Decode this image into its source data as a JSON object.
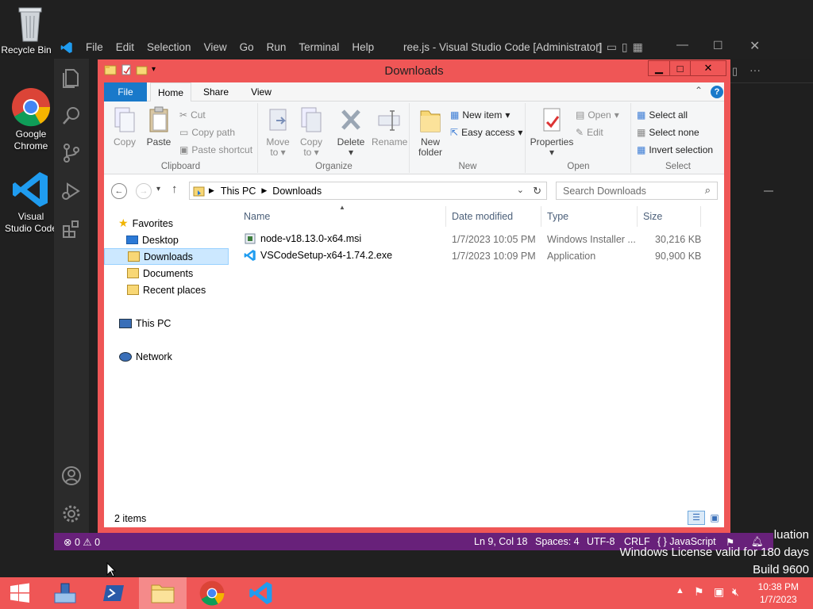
{
  "desktop": {
    "icons": [
      {
        "label": "Recycle Bin",
        "icon": "recycle-bin-icon"
      },
      {
        "label": "Google Chrome",
        "icon": "chrome-icon"
      },
      {
        "label": "Visual Studio Code",
        "icon": "vscode-icon"
      }
    ],
    "watermark": {
      "line1": "luation",
      "line2": "Windows License valid for 180 days",
      "line3": "Build 9600"
    }
  },
  "vscode": {
    "menu": [
      "File",
      "Edit",
      "Selection",
      "View",
      "Go",
      "Run",
      "Terminal",
      "Help"
    ],
    "title": "ree.js - Visual Studio Code [Administrator]",
    "status": {
      "errors": "0",
      "warnings": "0",
      "position": "Ln 9, Col 18",
      "spaces": "Spaces: 4",
      "encoding": "UTF-8",
      "eol": "CRLF",
      "language": "JavaScript"
    },
    "accent": "#68217a"
  },
  "explorer": {
    "title": "Downloads",
    "accent": "#ef5656",
    "tabs": [
      "File",
      "Home",
      "Share",
      "View"
    ],
    "ribbon": {
      "clipboard": {
        "copy": "Copy",
        "paste": "Paste",
        "cut": "Cut",
        "copy_path": "Copy path",
        "paste_shortcut": "Paste shortcut",
        "label": "Clipboard"
      },
      "organize": {
        "move_to": "Move",
        "move_to2": "to",
        "copy_to": "Copy",
        "copy_to2": "to",
        "delete": "Delete",
        "rename": "Rename",
        "label": "Organize"
      },
      "new": {
        "new_folder": "New",
        "new_folder2": "folder",
        "new_item": "New item",
        "easy_access": "Easy access",
        "label": "New"
      },
      "open": {
        "properties": "Properties",
        "open": "Open",
        "edit": "Edit",
        "label": "Open"
      },
      "select": {
        "select_all": "Select all",
        "select_none": "Select none",
        "invert": "Invert selection",
        "label": "Select"
      }
    },
    "address": {
      "segments": [
        "This PC",
        "Downloads"
      ]
    },
    "search_placeholder": "Search Downloads",
    "nav": {
      "favorites": "Favorites",
      "desktop": "Desktop",
      "downloads": "Downloads",
      "documents": "Documents",
      "recent": "Recent places",
      "this_pc": "This PC",
      "network": "Network"
    },
    "columns": {
      "name": "Name",
      "date": "Date modified",
      "type": "Type",
      "size": "Size"
    },
    "files": [
      {
        "name": "node-v18.13.0-x64.msi",
        "date": "1/7/2023 10:05 PM",
        "type": "Windows Installer ...",
        "size": "30,216 KB"
      },
      {
        "name": "VSCodeSetup-x64-1.74.2.exe",
        "date": "1/7/2023 10:09 PM",
        "type": "Application",
        "size": "90,900 KB"
      }
    ],
    "status": "2 items"
  },
  "taskbar": {
    "accent": "#ef5656",
    "clock": {
      "time": "10:38 PM",
      "date": "1/7/2023"
    }
  }
}
